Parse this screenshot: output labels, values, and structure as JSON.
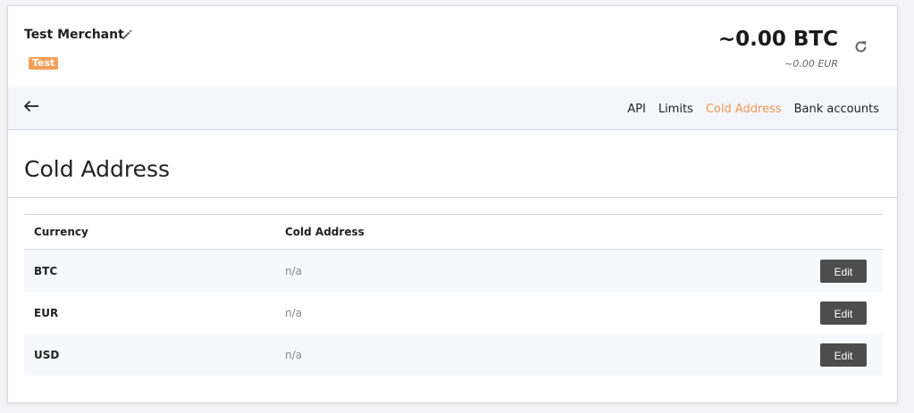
{
  "header": {
    "merchant_name": "Test Merchant",
    "badge": "Test",
    "badge_color": "#f5a05a",
    "balance_btc": "~0.00 BTC",
    "balance_fiat": "~0.00 EUR",
    "edit_icon": "pencil-icon",
    "refresh_icon": "refresh-icon"
  },
  "nav": {
    "back_icon": "arrow-left-icon",
    "links": [
      {
        "label": "API",
        "active": false
      },
      {
        "label": "Limits",
        "active": false
      },
      {
        "label": "Cold Address",
        "active": true
      },
      {
        "label": "Bank accounts",
        "active": false
      }
    ],
    "active_color": "#f0954f"
  },
  "page": {
    "title": "Cold Address"
  },
  "table": {
    "columns": [
      "Currency",
      "Cold Address",
      ""
    ],
    "rows": [
      {
        "currency": "BTC",
        "address": "n/a",
        "action": "Edit"
      },
      {
        "currency": "EUR",
        "address": "n/a",
        "action": "Edit"
      },
      {
        "currency": "USD",
        "address": "n/a",
        "action": "Edit"
      }
    ]
  }
}
